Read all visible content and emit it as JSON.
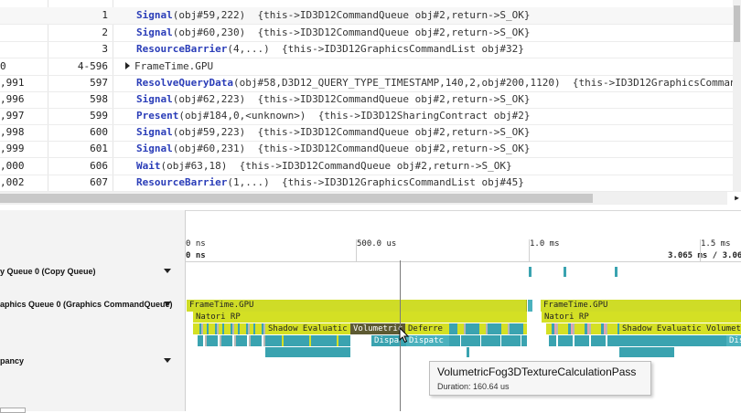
{
  "api_table": {
    "rows": [
      {
        "col0": "",
        "call_id": "1",
        "func": "Signal",
        "args": "(obj#59,222)",
        "note": "{this->ID3D12CommandQueue obj#2,return->S_OK}"
      },
      {
        "col0": "",
        "call_id": "2",
        "func": "Signal",
        "args": "(obj#60,230)",
        "note": "{this->ID3D12CommandQueue obj#2,return->S_OK}"
      },
      {
        "col0": "",
        "call_id": "3",
        "func": "ResourceBarrier",
        "args": "(4,...)",
        "note": "{this->ID3D12GraphicsCommandList obj#32}"
      },
      {
        "col0": "0",
        "call_id": "4-596",
        "func": "",
        "args": "FrameTime.GPU",
        "note": "",
        "group": true
      },
      {
        "col0": ",991",
        "call_id": "597",
        "func": "ResolveQueryData",
        "args": "(obj#58,D3D12_QUERY_TYPE_TIMESTAMP,140,2,obj#200,1120)",
        "note": "{this->ID3D12GraphicsCommand"
      },
      {
        "col0": ",996",
        "call_id": "598",
        "func": "Signal",
        "args": "(obj#62,223)",
        "note": "{this->ID3D12CommandQueue obj#2,return->S_OK}"
      },
      {
        "col0": ",997",
        "call_id": "599",
        "func": "Present",
        "args": "(obj#184,0,<unknown>)",
        "note": "{this->ID3D12SharingContract obj#2}"
      },
      {
        "col0": ",998",
        "call_id": "600",
        "func": "Signal",
        "args": "(obj#59,223)",
        "note": "{this->ID3D12CommandQueue obj#2,return->S_OK}"
      },
      {
        "col0": ",999",
        "call_id": "601",
        "func": "Signal",
        "args": "(obj#60,231)",
        "note": "{this->ID3D12CommandQueue obj#2,return->S_OK}"
      },
      {
        "col0": ",000",
        "call_id": "606",
        "func": "Wait",
        "args": "(obj#63,18)",
        "note": "{this->ID3D12CommandQueue obj#2,return->S_OK}"
      },
      {
        "col0": ",002",
        "call_id": "607",
        "func": "ResourceBarrier",
        "args": "(1,...)",
        "note": "{this->ID3D12GraphicsCommandList obj#45}"
      }
    ]
  },
  "timeline": {
    "ruler": {
      "labels": [
        "0 ns",
        "500.0 us",
        "1.0 ms",
        "1.5 ms"
      ],
      "range_start": "0 ns",
      "range_end": "3.065 ms / 3.065"
    },
    "lanes": [
      {
        "label": "y Queue 0 (Copy Queue)"
      },
      {
        "label": "aphics Queue 0 (Graphics CommandQueue)"
      },
      {
        "label": "pancy"
      }
    ],
    "bars": {
      "frame_time_1": "FrameTime.GPU",
      "frame_time_2": "FrameTime.GPU",
      "natori_1": "Natori RP",
      "natori_2": "Natori RP",
      "shadow_1": "Shadow Evaluatic",
      "volumetric": "Volumetric",
      "deferred": "Deferre",
      "shadow_2": "Shadow Evaluatic",
      "volumetric_2": "Volumet",
      "dispatch_1": "Dispa",
      "dispatch_2": "Dispatc",
      "dispatch_3": "Dis"
    },
    "tooltip": {
      "title": "VolumetricFog3DTextureCalculationPass",
      "duration": "Duration: 160.64 us"
    }
  },
  "colors": {
    "function_name": "#2a3db8",
    "bar_yellow": "#d4e024",
    "bar_teal": "#3aa3b0",
    "bar_selected": "#5d5a33"
  }
}
